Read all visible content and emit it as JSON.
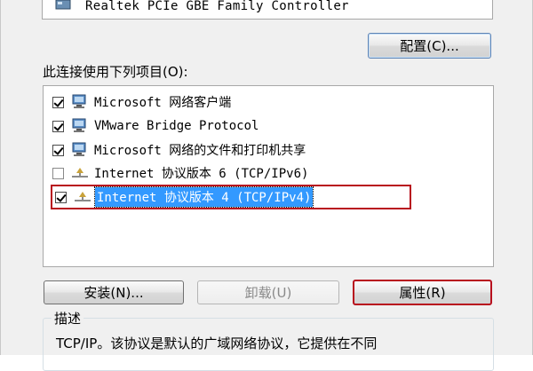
{
  "adapter": {
    "name": "Realtek PCIe GBE Family Controller"
  },
  "buttons": {
    "configure": "配置(C)...",
    "install": "安装(N)...",
    "uninstall": "卸载(U)",
    "properties": "属性(R)"
  },
  "list": {
    "heading": "此连接使用下列项目(O):",
    "items": [
      {
        "label": "Microsoft 网络客户端",
        "checked": true,
        "icon": "network-client-icon"
      },
      {
        "label": "VMware Bridge Protocol",
        "checked": true,
        "icon": "network-service-icon"
      },
      {
        "label": "Microsoft 网络的文件和打印机共享",
        "checked": true,
        "icon": "network-service-icon"
      },
      {
        "label": "Internet 协议版本 6 (TCP/IPv6)",
        "checked": false,
        "icon": "protocol-icon"
      },
      {
        "label": "Internet 协议版本 4 (TCP/IPv4)",
        "checked": true,
        "icon": "protocol-icon",
        "selected": true
      }
    ]
  },
  "description": {
    "title": "描述",
    "text": "TCP/IP。该协议是默认的广域网络协议，它提供在不同"
  },
  "colors": {
    "highlight_outline": "#b8101e",
    "selection": "#3399ff",
    "dialog_bg": "#f0f0f0"
  }
}
